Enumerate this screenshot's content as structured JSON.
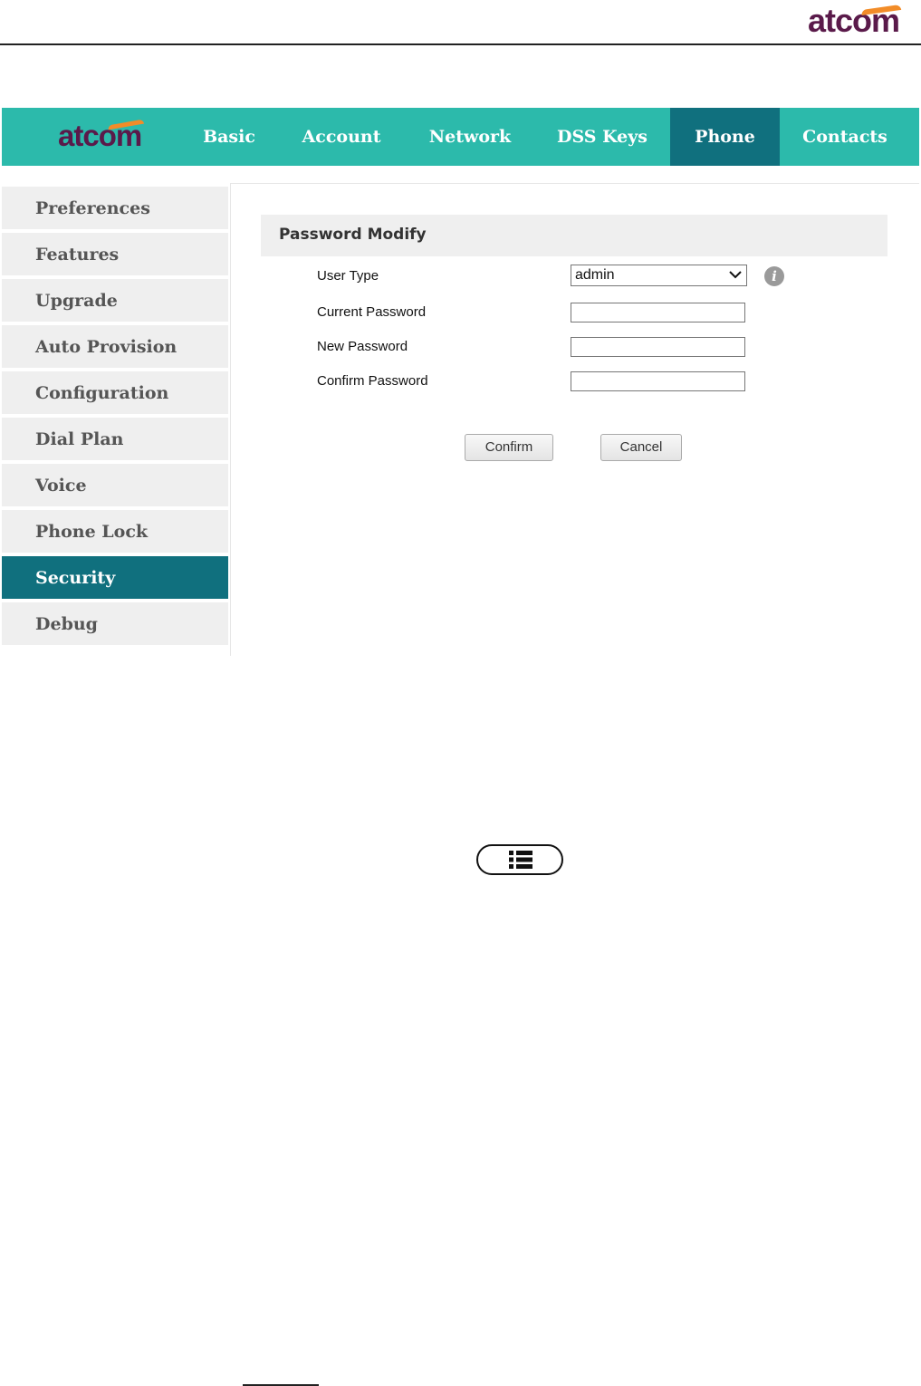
{
  "document": {
    "brand": "atcom"
  },
  "app": {
    "brand": "atcom",
    "nav_tabs": [
      {
        "label": "Basic"
      },
      {
        "label": "Account"
      },
      {
        "label": "Network"
      },
      {
        "label": "DSS Keys"
      },
      {
        "label": "Phone",
        "active": true
      },
      {
        "label": "Contacts"
      }
    ],
    "sidebar_items": [
      {
        "label": "Preferences"
      },
      {
        "label": "Features"
      },
      {
        "label": "Upgrade"
      },
      {
        "label": "Auto Provision"
      },
      {
        "label": "Configuration"
      },
      {
        "label": "Dial Plan"
      },
      {
        "label": "Voice"
      },
      {
        "label": "Phone Lock"
      },
      {
        "label": "Security",
        "active": true
      },
      {
        "label": "Debug"
      }
    ],
    "panel": {
      "title": "Password Modify",
      "fields": {
        "user_type_label": "User Type",
        "user_type_value": "admin",
        "current_password_label": "Current Password",
        "current_password_value": "",
        "new_password_label": "New Password",
        "new_password_value": "",
        "confirm_password_label": "Confirm Password",
        "confirm_password_value": ""
      },
      "info_glyph": "i",
      "buttons": {
        "confirm": "Confirm",
        "cancel": "Cancel"
      }
    }
  },
  "icons": {
    "menu_key": "menu-list-icon",
    "info": "info-icon",
    "dropdown": "chevron-down-icon"
  },
  "colors": {
    "nav_bg": "#2cbaab",
    "active_bg": "#10707e",
    "brand_purple": "#5a1a4a",
    "brand_orange": "#f28c28"
  }
}
